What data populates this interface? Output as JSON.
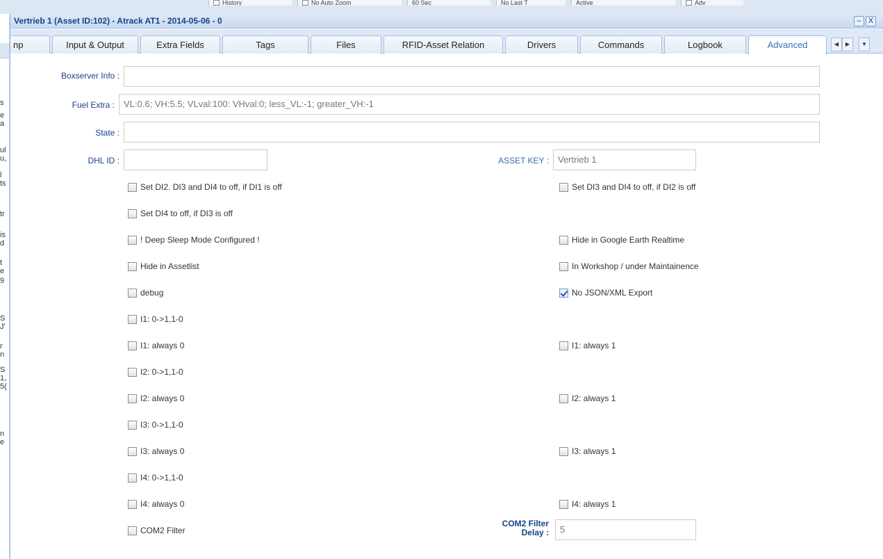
{
  "background": {
    "toolbar_items": [
      "History",
      "No Auto Zoom",
      "60 Sec",
      "No Last T",
      "Active",
      "Adv"
    ],
    "left_letters": [
      "s",
      "e",
      "a",
      "ul",
      "u,",
      "l",
      "ts",
      "tr",
      "is",
      "d",
      "t",
      "e",
      "9",
      "S",
      "J'",
      "r",
      "n",
      "S",
      "1,",
      "5(",
      "n",
      "e"
    ]
  },
  "window": {
    "title": "Vertrieb 1 (Asset ID:102) - Atrack AT1 - 2014-05-06 - 0",
    "minimize_glyph": "–",
    "close_glyph": "X"
  },
  "tabs": [
    {
      "label": "np"
    },
    {
      "label": "Input & Output"
    },
    {
      "label": "Extra Fields"
    },
    {
      "label": "Tags"
    },
    {
      "label": "Files"
    },
    {
      "label": "RFID-Asset Relation"
    },
    {
      "label": "Drivers"
    },
    {
      "label": "Commands"
    },
    {
      "label": "Logbook"
    },
    {
      "label": "Advanced",
      "active": true
    }
  ],
  "tab_scroll": {
    "left": "◀",
    "right": "▶",
    "menu": "▼"
  },
  "form": {
    "boxserver_info": {
      "label": "Boxserver Info :",
      "value": ""
    },
    "fuel_extra": {
      "label": "Fuel Extra :",
      "value": "VL:0.6; VH:5.5; VLval:100: VHval:0; less_VL:-1;  greater_VH:-1"
    },
    "state": {
      "label": "State :",
      "value": ""
    },
    "dhl_id": {
      "label": "DHL ID :",
      "value": ""
    },
    "asset_key": {
      "label": "ASSET KEY :",
      "value": "Vertrieb 1"
    },
    "com2_filter_delay": {
      "label_line1": "COM2 Filter",
      "label_line2": "Delay :",
      "value": "5"
    }
  },
  "checkboxes_left": [
    {
      "label": "Set DI2. DI3 and DI4 to off, if DI1 is off",
      "checked": false
    },
    {
      "label": "Set DI4 to off, if DI3 is off",
      "checked": false
    },
    {
      "label": "! Deep Sleep Mode Configured !",
      "checked": false
    },
    {
      "label": "Hide in Assetlist",
      "checked": false
    },
    {
      "label": "debug",
      "checked": false
    },
    {
      "label": "I1: 0->1,1-0",
      "checked": false
    },
    {
      "label": "I1: always 0",
      "checked": false
    },
    {
      "label": "I2: 0->1,1-0",
      "checked": false
    },
    {
      "label": "I2: always 0",
      "checked": false
    },
    {
      "label": "I3: 0->1,1-0",
      "checked": false
    },
    {
      "label": "I3: always 0",
      "checked": false
    },
    {
      "label": "I4: 0->1,1-0",
      "checked": false
    },
    {
      "label": "I4: always 0",
      "checked": false
    },
    {
      "label": "COM2 Filter",
      "checked": false
    }
  ],
  "checkboxes_right": [
    {
      "label": "Set DI3 and DI4 to off, if DI2 is off",
      "checked": false
    },
    {
      "label": "Hide in Google Earth Realtime",
      "checked": false
    },
    {
      "label": "In Workshop / under Maintainence",
      "checked": false
    },
    {
      "label": "No JSON/XML Export",
      "checked": true
    },
    {
      "label": "I1: always 1",
      "checked": false
    },
    {
      "label": "I2: always 1",
      "checked": false
    },
    {
      "label": "I3: always 1",
      "checked": false
    },
    {
      "label": "I4: always 1",
      "checked": false
    }
  ]
}
